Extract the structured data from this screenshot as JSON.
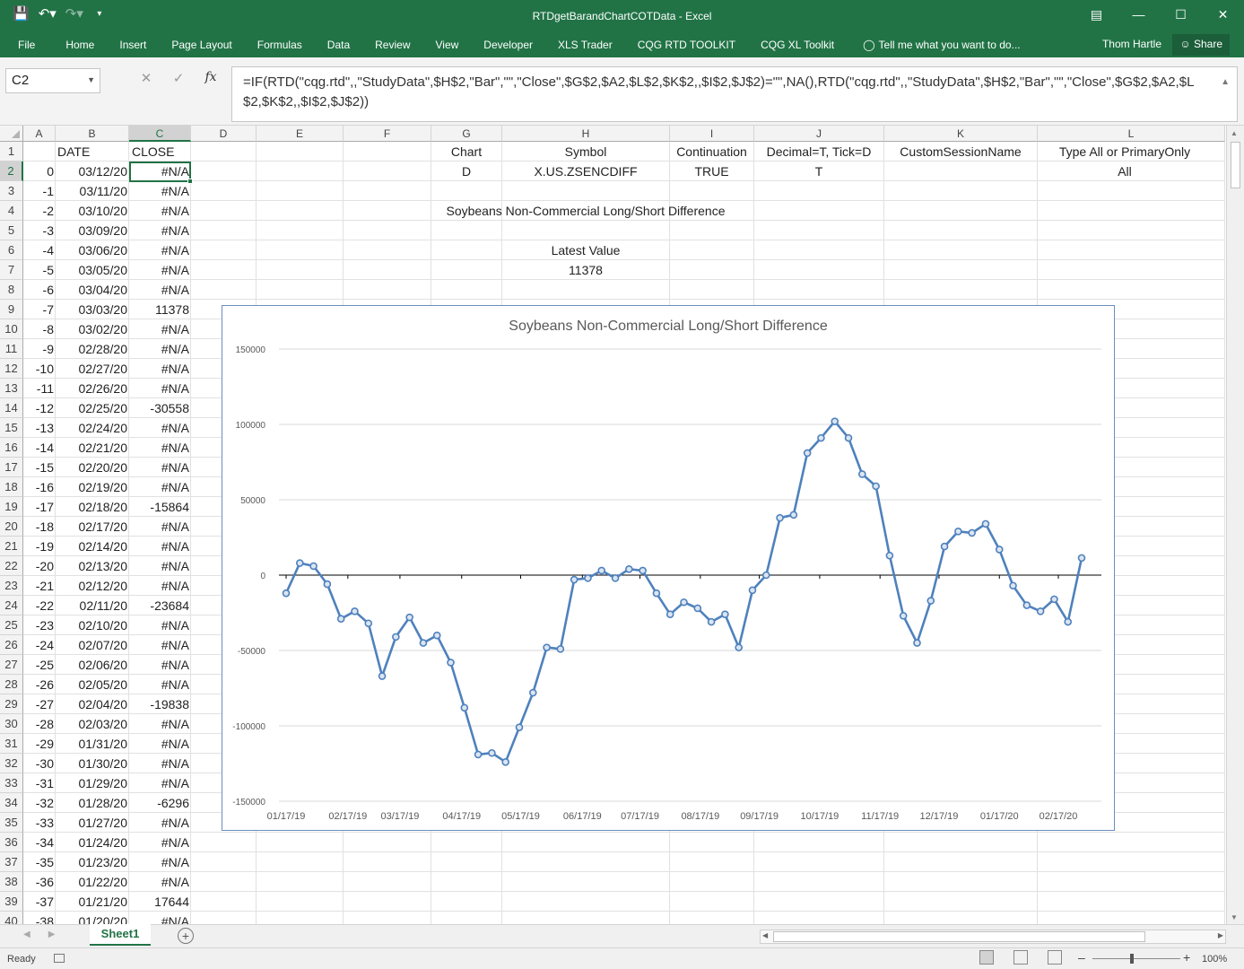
{
  "window": {
    "title": "RTDgetBarandChartCOTData - Excel",
    "user": "Thom Hartle",
    "share": "Share"
  },
  "qat": {
    "save_icon": "save-icon",
    "undo_icon": "undo-icon",
    "redo_icon": "redo-icon"
  },
  "ribbon": {
    "tabs": [
      "File",
      "Home",
      "Insert",
      "Page Layout",
      "Formulas",
      "Data",
      "Review",
      "View",
      "Developer",
      "XLS Trader",
      "CQG RTD TOOLKIT",
      "CQG XL Toolkit"
    ],
    "tellme": "Tell me what you want to do..."
  },
  "formula_bar": {
    "name_box": "C2",
    "fx": "fx",
    "formula": "=IF(RTD(\"cqg.rtd\",,\"StudyData\",$H$2,\"Bar\",\"\",\"Close\",$G$2,$A2,$L$2,$K$2,,$I$2,$J$2)=\"\",NA(),RTD(\"cqg.rtd\",,\"StudyData\",$H$2,\"Bar\",\"\",\"Close\",$G$2,$A2,$L$2,$K$2,,$I$2,$J$2))"
  },
  "columns": [
    "A",
    "B",
    "C",
    "D",
    "E",
    "F",
    "G",
    "H",
    "I",
    "J",
    "K",
    "L"
  ],
  "row_numbers": [
    "1",
    "2",
    "3",
    "4",
    "5",
    "6",
    "7",
    "8",
    "9",
    "10",
    "11",
    "12",
    "13",
    "14",
    "15",
    "16",
    "17",
    "18",
    "19",
    "20",
    "21",
    "22",
    "23",
    "24",
    "25",
    "26",
    "27",
    "28",
    "29",
    "30",
    "31",
    "32",
    "33",
    "34",
    "35",
    "36",
    "37",
    "38",
    "39",
    "40"
  ],
  "headers_row1": {
    "B": "DATE",
    "C": "CLOSE",
    "G": "Chart",
    "H": "Symbol",
    "I": "Continuation",
    "J": "Decimal=T, Tick=D",
    "K": "CustomSessionName",
    "L": "Type All or PrimaryOnly"
  },
  "params_row2": {
    "G": "D",
    "H": "X.US.ZSENCDIFF",
    "I": "TRUE",
    "J": "T",
    "L": "All"
  },
  "label_h4": "Soybeans Non-Commercial Long/Short Difference",
  "label_h6": "Latest Value",
  "label_h7": "11378",
  "data_rows": [
    [
      "0",
      "03/12/20",
      "#N/A"
    ],
    [
      "-1",
      "03/11/20",
      "#N/A"
    ],
    [
      "-2",
      "03/10/20",
      "#N/A"
    ],
    [
      "-3",
      "03/09/20",
      "#N/A"
    ],
    [
      "-4",
      "03/06/20",
      "#N/A"
    ],
    [
      "-5",
      "03/05/20",
      "#N/A"
    ],
    [
      "-6",
      "03/04/20",
      "#N/A"
    ],
    [
      "-7",
      "03/03/20",
      "11378"
    ],
    [
      "-8",
      "03/02/20",
      "#N/A"
    ],
    [
      "-9",
      "02/28/20",
      "#N/A"
    ],
    [
      "-10",
      "02/27/20",
      "#N/A"
    ],
    [
      "-11",
      "02/26/20",
      "#N/A"
    ],
    [
      "-12",
      "02/25/20",
      "-30558"
    ],
    [
      "-13",
      "02/24/20",
      "#N/A"
    ],
    [
      "-14",
      "02/21/20",
      "#N/A"
    ],
    [
      "-15",
      "02/20/20",
      "#N/A"
    ],
    [
      "-16",
      "02/19/20",
      "#N/A"
    ],
    [
      "-17",
      "02/18/20",
      "-15864"
    ],
    [
      "-18",
      "02/17/20",
      "#N/A"
    ],
    [
      "-19",
      "02/14/20",
      "#N/A"
    ],
    [
      "-20",
      "02/13/20",
      "#N/A"
    ],
    [
      "-21",
      "02/12/20",
      "#N/A"
    ],
    [
      "-22",
      "02/11/20",
      "-23684"
    ],
    [
      "-23",
      "02/10/20",
      "#N/A"
    ],
    [
      "-24",
      "02/07/20",
      "#N/A"
    ],
    [
      "-25",
      "02/06/20",
      "#N/A"
    ],
    [
      "-26",
      "02/05/20",
      "#N/A"
    ],
    [
      "-27",
      "02/04/20",
      "-19838"
    ],
    [
      "-28",
      "02/03/20",
      "#N/A"
    ],
    [
      "-29",
      "01/31/20",
      "#N/A"
    ],
    [
      "-30",
      "01/30/20",
      "#N/A"
    ],
    [
      "-31",
      "01/29/20",
      "#N/A"
    ],
    [
      "-32",
      "01/28/20",
      "-6296"
    ],
    [
      "-33",
      "01/27/20",
      "#N/A"
    ],
    [
      "-34",
      "01/24/20",
      "#N/A"
    ],
    [
      "-35",
      "01/23/20",
      "#N/A"
    ],
    [
      "-36",
      "01/22/20",
      "#N/A"
    ],
    [
      "-37",
      "01/21/20",
      "17644"
    ],
    [
      "-38",
      "01/20/20",
      "#N/A"
    ]
  ],
  "chart_data": {
    "type": "line",
    "title": "Soybeans Non-Commercial Long/Short Difference",
    "ylim": [
      -150000,
      150000
    ],
    "yticks": [
      150000,
      100000,
      50000,
      0,
      -50000,
      -100000,
      -150000
    ],
    "ytick_labels": [
      "150000",
      "100000",
      "50000",
      "0",
      "-50000",
      "-100000",
      "-150000"
    ],
    "xtick_labels": [
      "01/17/19",
      "02/17/19",
      "03/17/19",
      "04/17/19",
      "05/17/19",
      "06/17/19",
      "07/17/19",
      "08/17/19",
      "09/17/19",
      "10/17/19",
      "11/17/19",
      "12/17/19",
      "01/17/20",
      "02/17/20"
    ],
    "xtick_index": [
      0,
      4.5,
      8.3,
      12.8,
      17.1,
      21.6,
      25.8,
      30.2,
      34.5,
      38.9,
      43.3,
      47.6,
      52,
      56.3
    ],
    "values": [
      -12000,
      8000,
      6000,
      -6000,
      -29000,
      -24000,
      -32000,
      -67000,
      -41000,
      -28000,
      -45000,
      -40000,
      -58000,
      -88000,
      -119000,
      -118000,
      -124000,
      -101000,
      -78000,
      -48000,
      -49000,
      -3000,
      -2000,
      3000,
      -2000,
      4000,
      3000,
      -12000,
      -26000,
      -18000,
      -22000,
      -31000,
      -26000,
      -48000,
      -10000,
      0,
      38000,
      40000,
      81000,
      91000,
      102000,
      91000,
      67000,
      59000,
      13000,
      -27000,
      -45000,
      -17000,
      19000,
      29000,
      28000,
      34000,
      17000,
      -7000,
      -20000,
      -24000,
      -16000,
      -31000,
      11378
    ],
    "grid": true,
    "legend": "none",
    "color": "#4f81bd"
  }
}
